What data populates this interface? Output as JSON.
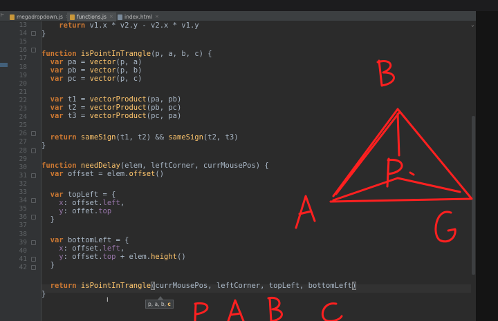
{
  "tabs": [
    {
      "label": "megadropdown.js",
      "icon": "js-file-icon",
      "active": false
    },
    {
      "label": "functions.js",
      "icon": "js-file-icon",
      "active": true
    },
    {
      "label": "index.html",
      "icon": "html-file-icon",
      "active": false
    }
  ],
  "colors": {
    "editor_bg": "#2b2b2b",
    "keyword": "#cc7832",
    "function": "#ffc66d",
    "property": "#9876aa",
    "annotation_ink": "#ff2020"
  },
  "line_numbers": [
    "13",
    "14",
    "15",
    "16",
    "17",
    "18",
    "19",
    "20",
    "21",
    "22",
    "23",
    "24",
    "25",
    "26",
    "27",
    "28",
    "29",
    "30",
    "31",
    "32",
    "33",
    "34",
    "35",
    "36",
    "37",
    "38",
    "39",
    "40",
    "41",
    "42"
  ],
  "code": {
    "l13a": "return",
    "l13b": " v1.x * v2.y - v2.x * v1.y",
    "l14": "}",
    "l16a": "function",
    "l16b": "isPointInTrangle",
    "l16c": "(p, a, b, c) {",
    "l17a": "var",
    "l17b": " pa = ",
    "l17c": "vector",
    "l17d": "(p, a)",
    "l18a": "var",
    "l18b": " pb = ",
    "l18c": "vector",
    "l18d": "(p, b)",
    "l19a": "var",
    "l19b": " pc = ",
    "l19c": "vector",
    "l19d": "(p, c)",
    "l21a": "var",
    "l21b": " t1 = ",
    "l21c": "vectorProduct",
    "l21d": "(pa, pb)",
    "l22a": "var",
    "l22b": " t2 = ",
    "l22c": "vectorProduct",
    "l22d": "(pb, pc)",
    "l23a": "var",
    "l23b": " t3 = ",
    "l23c": "vectorProduct",
    "l23d": "(pc, pa)",
    "l25a": "return",
    "l25b": "sameSign",
    "l25c": "(t1, t2) && ",
    "l25d": "sameSign",
    "l25e": "(t2, t3)",
    "l26": "}",
    "l28a": "function",
    "l28b": "needDelay",
    "l28c": "(elem, leftCorner, currMousePos) {",
    "l29a": "var",
    "l29b": " offset = elem.",
    "l29c": "offset",
    "l29d": "()",
    "l31a": "var",
    "l31b": " topLeft = {",
    "l32a": "x",
    "l32b": ": offset.",
    "l32c": "left",
    "l32d": ",",
    "l33a": "y",
    "l33b": ": offet.",
    "l33c": "top",
    "l34": "}",
    "l36a": "var",
    "l36b": " bottomLeft = {",
    "l37a": "x",
    "l37b": ": offset.",
    "l37c": "left",
    "l37d": ",",
    "l38a": "y",
    "l38b": ": offset.",
    "l38c": "top",
    "l38d": " + elem.",
    "l38e": "height",
    "l38f": "()",
    "l39": "}",
    "l41a": "return",
    "l41b": "isPointInTrangle",
    "l41c": "(",
    "l41d": "currMousePos, leftCorner, topLeft, bottomLeft",
    "l41e": ")",
    "l42": "}"
  },
  "tooltip": {
    "params": "p, a, b, ",
    "current": "c"
  }
}
